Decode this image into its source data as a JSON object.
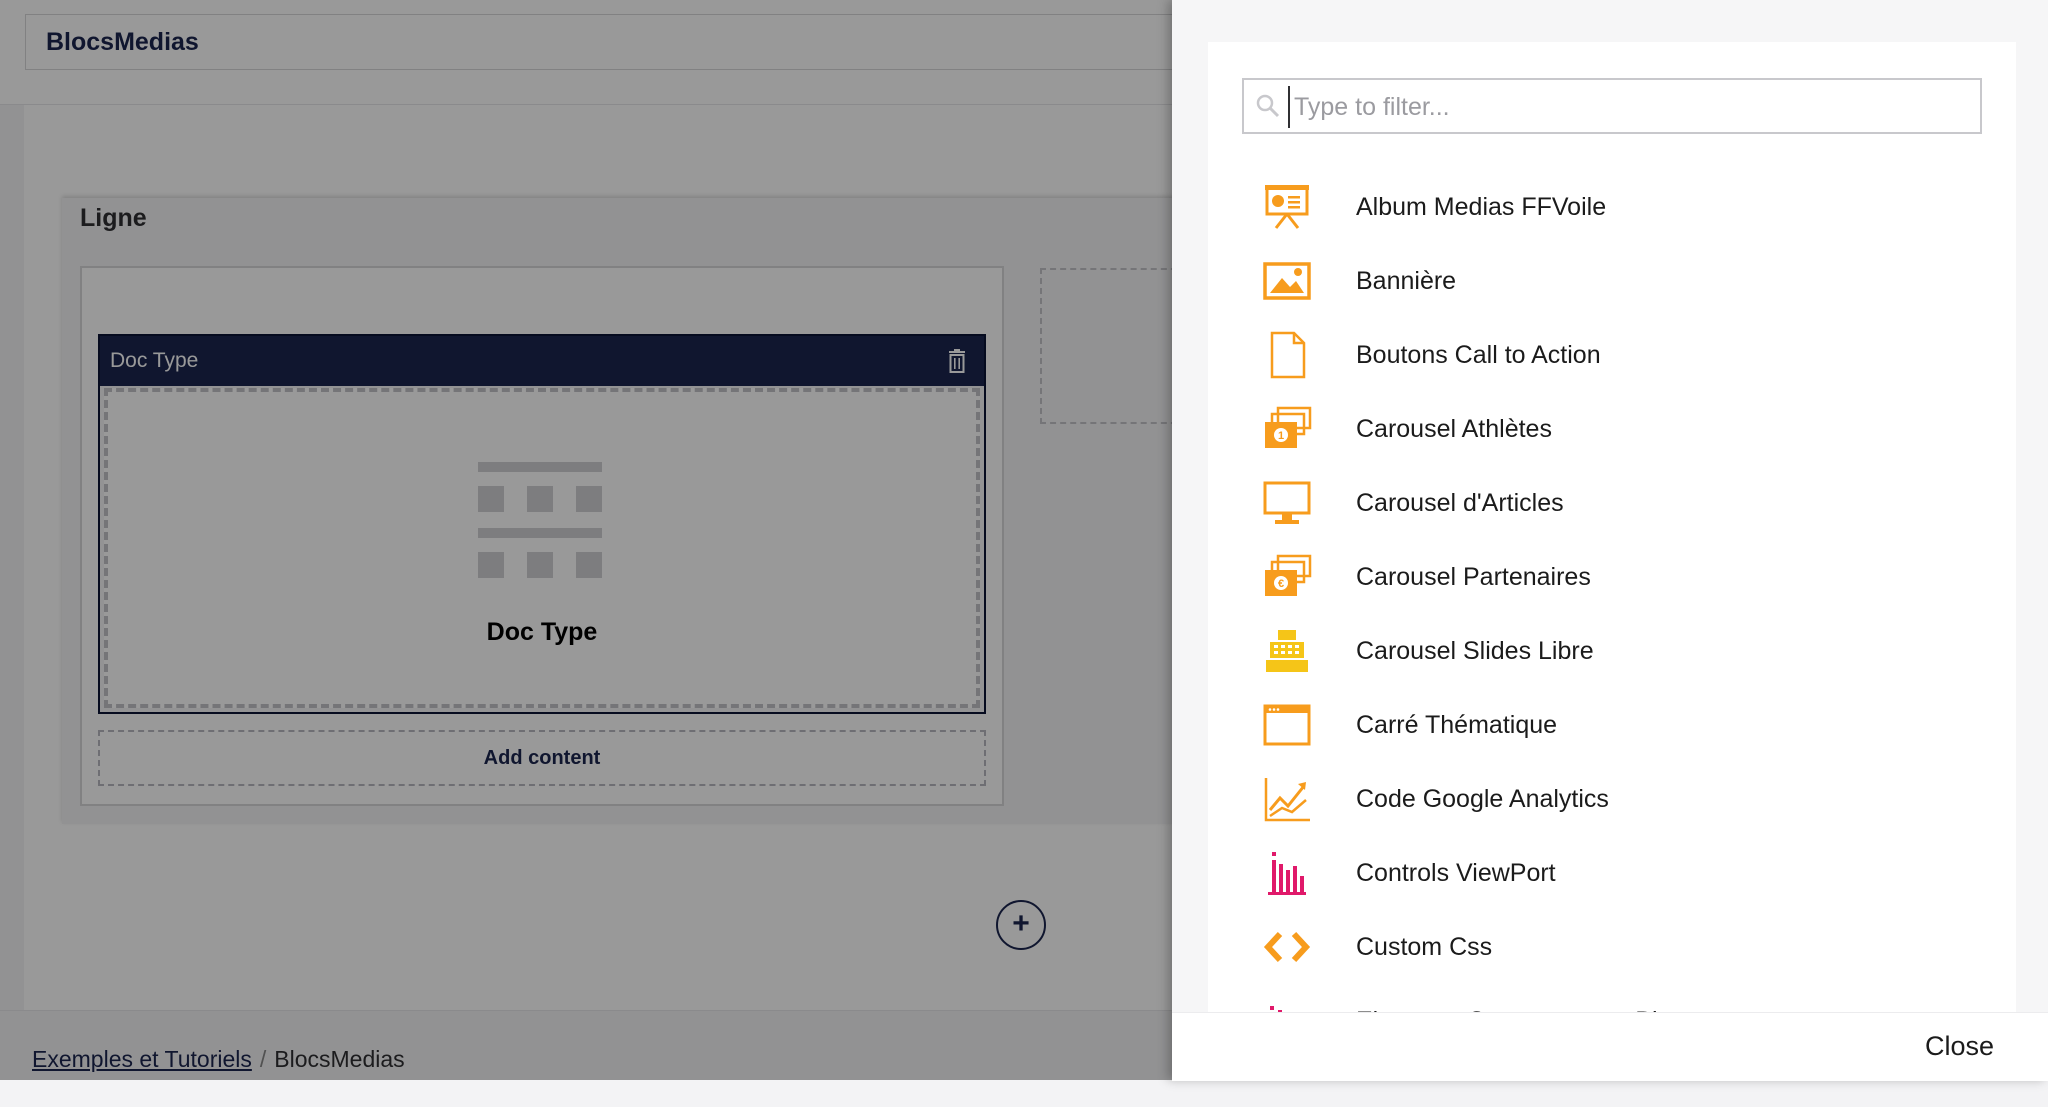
{
  "editor": {
    "doc_name": "BlocsMedias",
    "row_label": "Ligne",
    "block_title": "Doc Type",
    "block_name": "Doc Type",
    "add_content": "Add content",
    "add_row": "+"
  },
  "breadcrumb": {
    "items": [
      "Exemples et Tutoriels",
      "BlocsMedias"
    ],
    "separator": "/"
  },
  "picker": {
    "filter_placeholder": "Type to filter...",
    "filter_value": "",
    "close_label": "Close",
    "items": [
      {
        "label": "Album Medias FFVoile",
        "icon": "presentation-icon",
        "color": "#f79c1d"
      },
      {
        "label": "Bannière",
        "icon": "picture-icon",
        "color": "#f79c1d"
      },
      {
        "label": "Boutons Call to Action",
        "icon": "document-icon",
        "color": "#f79c1d"
      },
      {
        "label": "Carousel Athlètes",
        "icon": "money-stack-icon",
        "color": "#f79c1d"
      },
      {
        "label": "Carousel d'Articles",
        "icon": "monitor-icon",
        "color": "#f79c1d"
      },
      {
        "label": "Carousel Partenaires",
        "icon": "euro-stack-icon",
        "color": "#f79c1d"
      },
      {
        "label": "Carousel Slides Libre",
        "icon": "cash-register-icon",
        "color": "#f5c518"
      },
      {
        "label": "Carré Thématique",
        "icon": "browser-window-icon",
        "color": "#f79c1d"
      },
      {
        "label": "Code Google Analytics",
        "icon": "line-chart-icon",
        "color": "#f79c1d"
      },
      {
        "label": "Controls ViewPort",
        "icon": "bar-chart-icon",
        "color": "#e0196a"
      },
      {
        "label": "Custom Css",
        "icon": "code-icon",
        "color": "#f79c1d"
      },
      {
        "label": "Elements Communs aux Blocs",
        "icon": "dots-grid-icon",
        "color": "#e0196a"
      }
    ]
  },
  "colors": {
    "accent": "#1b264f",
    "icon_orange": "#f79c1d",
    "icon_pink": "#e0196a"
  }
}
